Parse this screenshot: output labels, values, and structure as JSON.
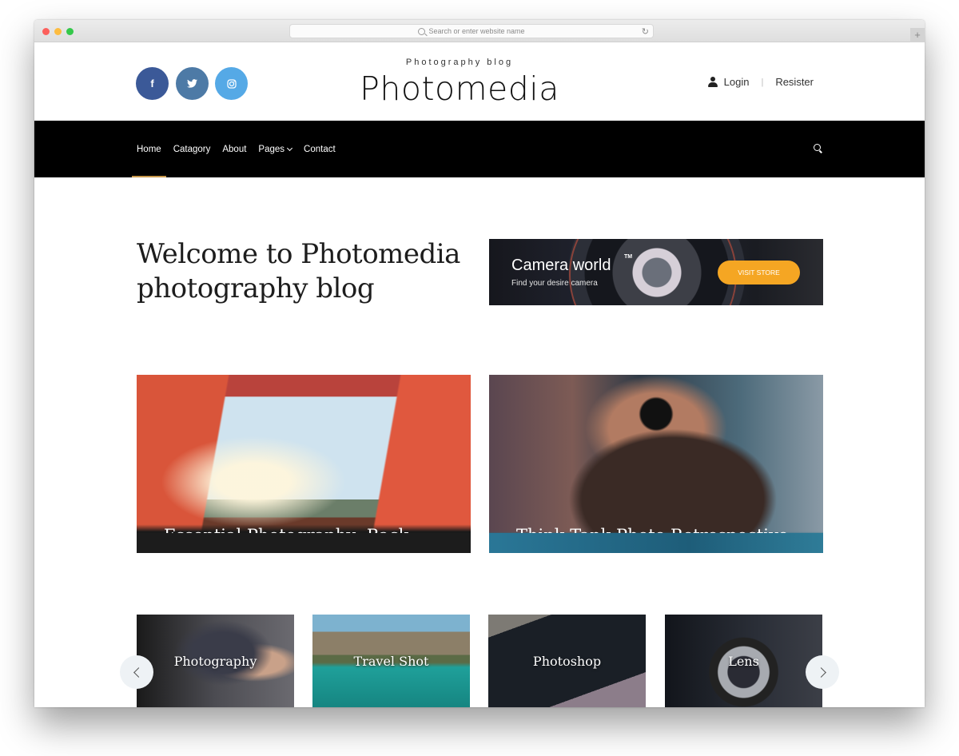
{
  "browser": {
    "url_placeholder": "Search or enter website name",
    "reload_icon": "↻",
    "new_tab_icon": "+"
  },
  "header": {
    "social": [
      {
        "name": "facebook",
        "glyph": "f",
        "color": "#3b5998"
      },
      {
        "name": "twitter",
        "glyph": "t",
        "color": "#4d7aa6"
      },
      {
        "name": "instagram",
        "glyph": "◎",
        "color": "#55a9e6"
      }
    ],
    "tagline": "Photography blog",
    "brand": "Photomedia",
    "login": "Login",
    "separator": "|",
    "register": "Resister"
  },
  "nav": {
    "items": [
      {
        "label": "Home",
        "active": true
      },
      {
        "label": "Catagory"
      },
      {
        "label": "About"
      },
      {
        "label": "Pages",
        "has_dropdown": true
      },
      {
        "label": "Contact"
      }
    ],
    "accent": "#c7974a"
  },
  "hero": {
    "heading": "Welcome to Photomedia photography blog",
    "banner": {
      "title": "Camera world",
      "trademark": "TM",
      "subtitle": "Find your desire camera",
      "cta": "VISIT STORE",
      "cta_color": "#f5a623"
    }
  },
  "posts": [
    {
      "title": "Essential Photography: Back"
    },
    {
      "title": "Think Tank Photo Retrospective"
    }
  ],
  "categories": [
    {
      "label": "Photography"
    },
    {
      "label": "Travel Shot"
    },
    {
      "label": "Photoshop"
    },
    {
      "label": "Lens"
    }
  ]
}
